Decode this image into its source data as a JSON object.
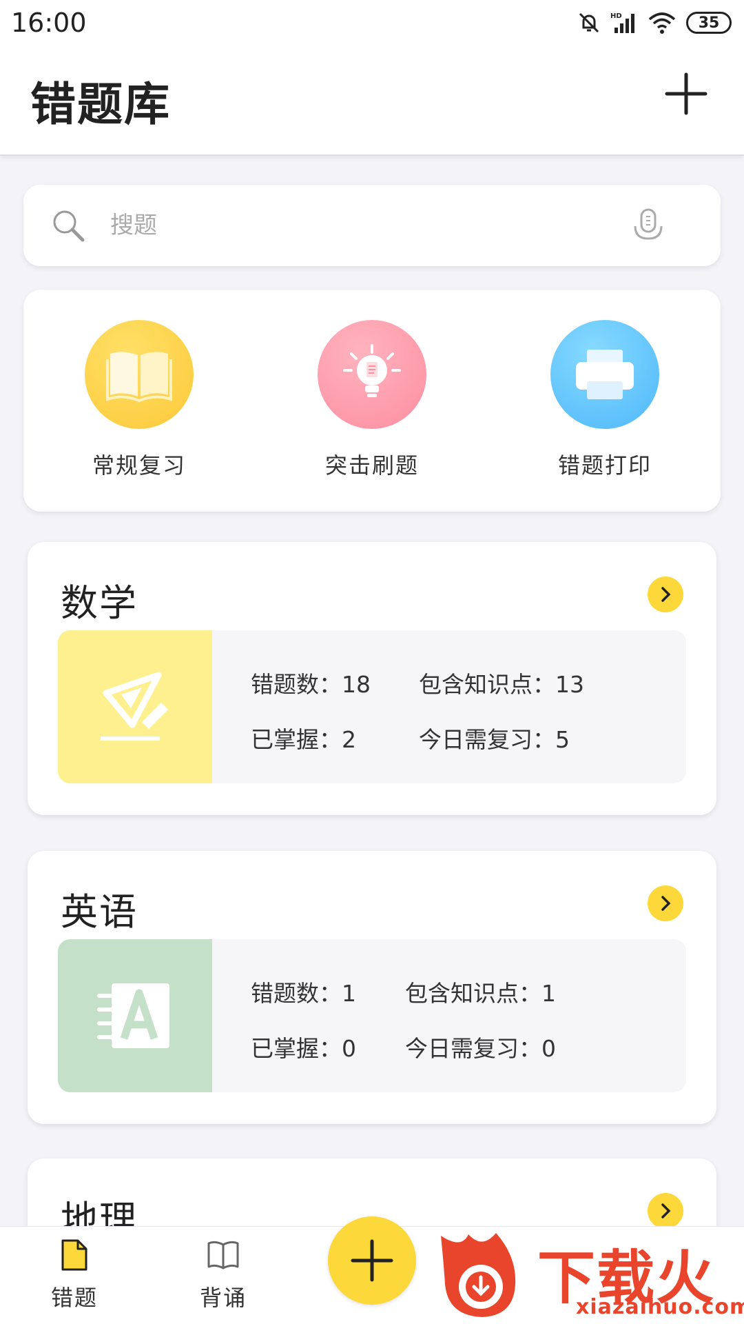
{
  "status_bar": {
    "time": "16:00",
    "battery": "35"
  },
  "header": {
    "title": "错题库"
  },
  "search": {
    "placeholder": "搜题"
  },
  "quick_actions": [
    {
      "label": "常规复习",
      "color": "#fcc93a"
    },
    {
      "label": "突击刷题",
      "color": "#fe8ea0"
    },
    {
      "label": "错题打印",
      "color": "#4fb8fb"
    }
  ],
  "subjects": [
    {
      "name": "数学",
      "thumb_color": "#fff08f",
      "stats": {
        "wrong_label": "错题数",
        "wrong": "18",
        "knowledge_label": "包含知识点",
        "knowledge": "13",
        "mastered_label": "已掌握",
        "mastered": "2",
        "review_label": "今日需复习",
        "review": "5"
      }
    },
    {
      "name": "英语",
      "thumb_color": "#c4e0c8",
      "stats": {
        "wrong_label": "错题数",
        "wrong": "1",
        "knowledge_label": "包含知识点",
        "knowledge": "1",
        "mastered_label": "已掌握",
        "mastered": "0",
        "review_label": "今日需复习",
        "review": "0"
      }
    },
    {
      "name": "地理"
    }
  ],
  "bottom_nav": {
    "items": [
      {
        "label": "错题"
      },
      {
        "label": "背诵"
      }
    ]
  },
  "watermark": {
    "text": "下载火",
    "url": "xiazaihuo.com"
  },
  "colors": {
    "accent": "#fdd83a",
    "watermark": "#e9442c"
  }
}
